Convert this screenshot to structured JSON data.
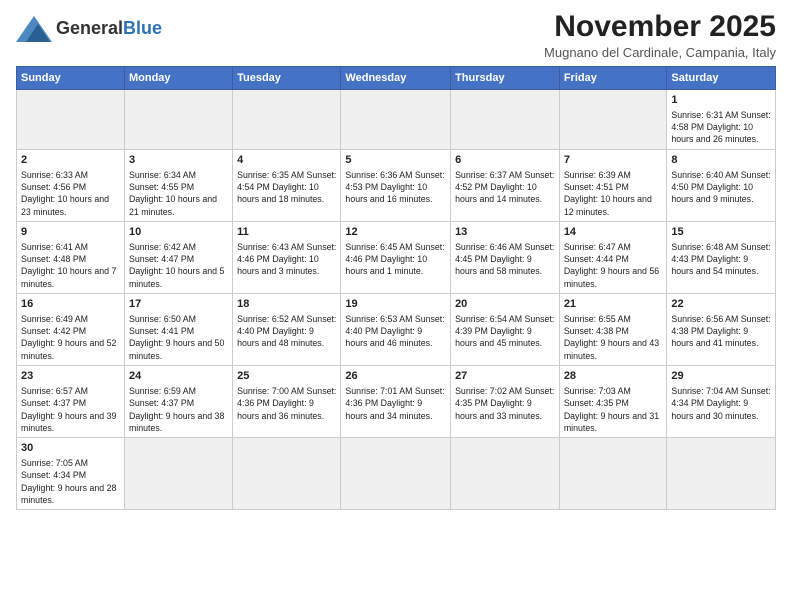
{
  "header": {
    "logo_general": "General",
    "logo_blue": "Blue",
    "month_title": "November 2025",
    "location": "Mugnano del Cardinale, Campania, Italy"
  },
  "weekdays": [
    "Sunday",
    "Monday",
    "Tuesday",
    "Wednesday",
    "Thursday",
    "Friday",
    "Saturday"
  ],
  "weeks": [
    [
      {
        "day": "",
        "info": ""
      },
      {
        "day": "",
        "info": ""
      },
      {
        "day": "",
        "info": ""
      },
      {
        "day": "",
        "info": ""
      },
      {
        "day": "",
        "info": ""
      },
      {
        "day": "",
        "info": ""
      },
      {
        "day": "1",
        "info": "Sunrise: 6:31 AM\nSunset: 4:58 PM\nDaylight: 10 hours and 26 minutes."
      }
    ],
    [
      {
        "day": "2",
        "info": "Sunrise: 6:33 AM\nSunset: 4:56 PM\nDaylight: 10 hours and 23 minutes."
      },
      {
        "day": "3",
        "info": "Sunrise: 6:34 AM\nSunset: 4:55 PM\nDaylight: 10 hours and 21 minutes."
      },
      {
        "day": "4",
        "info": "Sunrise: 6:35 AM\nSunset: 4:54 PM\nDaylight: 10 hours and 18 minutes."
      },
      {
        "day": "5",
        "info": "Sunrise: 6:36 AM\nSunset: 4:53 PM\nDaylight: 10 hours and 16 minutes."
      },
      {
        "day": "6",
        "info": "Sunrise: 6:37 AM\nSunset: 4:52 PM\nDaylight: 10 hours and 14 minutes."
      },
      {
        "day": "7",
        "info": "Sunrise: 6:39 AM\nSunset: 4:51 PM\nDaylight: 10 hours and 12 minutes."
      },
      {
        "day": "8",
        "info": "Sunrise: 6:40 AM\nSunset: 4:50 PM\nDaylight: 10 hours and 9 minutes."
      }
    ],
    [
      {
        "day": "9",
        "info": "Sunrise: 6:41 AM\nSunset: 4:48 PM\nDaylight: 10 hours and 7 minutes."
      },
      {
        "day": "10",
        "info": "Sunrise: 6:42 AM\nSunset: 4:47 PM\nDaylight: 10 hours and 5 minutes."
      },
      {
        "day": "11",
        "info": "Sunrise: 6:43 AM\nSunset: 4:46 PM\nDaylight: 10 hours and 3 minutes."
      },
      {
        "day": "12",
        "info": "Sunrise: 6:45 AM\nSunset: 4:46 PM\nDaylight: 10 hours and 1 minute."
      },
      {
        "day": "13",
        "info": "Sunrise: 6:46 AM\nSunset: 4:45 PM\nDaylight: 9 hours and 58 minutes."
      },
      {
        "day": "14",
        "info": "Sunrise: 6:47 AM\nSunset: 4:44 PM\nDaylight: 9 hours and 56 minutes."
      },
      {
        "day": "15",
        "info": "Sunrise: 6:48 AM\nSunset: 4:43 PM\nDaylight: 9 hours and 54 minutes."
      }
    ],
    [
      {
        "day": "16",
        "info": "Sunrise: 6:49 AM\nSunset: 4:42 PM\nDaylight: 9 hours and 52 minutes."
      },
      {
        "day": "17",
        "info": "Sunrise: 6:50 AM\nSunset: 4:41 PM\nDaylight: 9 hours and 50 minutes."
      },
      {
        "day": "18",
        "info": "Sunrise: 6:52 AM\nSunset: 4:40 PM\nDaylight: 9 hours and 48 minutes."
      },
      {
        "day": "19",
        "info": "Sunrise: 6:53 AM\nSunset: 4:40 PM\nDaylight: 9 hours and 46 minutes."
      },
      {
        "day": "20",
        "info": "Sunrise: 6:54 AM\nSunset: 4:39 PM\nDaylight: 9 hours and 45 minutes."
      },
      {
        "day": "21",
        "info": "Sunrise: 6:55 AM\nSunset: 4:38 PM\nDaylight: 9 hours and 43 minutes."
      },
      {
        "day": "22",
        "info": "Sunrise: 6:56 AM\nSunset: 4:38 PM\nDaylight: 9 hours and 41 minutes."
      }
    ],
    [
      {
        "day": "23",
        "info": "Sunrise: 6:57 AM\nSunset: 4:37 PM\nDaylight: 9 hours and 39 minutes."
      },
      {
        "day": "24",
        "info": "Sunrise: 6:59 AM\nSunset: 4:37 PM\nDaylight: 9 hours and 38 minutes."
      },
      {
        "day": "25",
        "info": "Sunrise: 7:00 AM\nSunset: 4:36 PM\nDaylight: 9 hours and 36 minutes."
      },
      {
        "day": "26",
        "info": "Sunrise: 7:01 AM\nSunset: 4:36 PM\nDaylight: 9 hours and 34 minutes."
      },
      {
        "day": "27",
        "info": "Sunrise: 7:02 AM\nSunset: 4:35 PM\nDaylight: 9 hours and 33 minutes."
      },
      {
        "day": "28",
        "info": "Sunrise: 7:03 AM\nSunset: 4:35 PM\nDaylight: 9 hours and 31 minutes."
      },
      {
        "day": "29",
        "info": "Sunrise: 7:04 AM\nSunset: 4:34 PM\nDaylight: 9 hours and 30 minutes."
      }
    ],
    [
      {
        "day": "30",
        "info": "Sunrise: 7:05 AM\nSunset: 4:34 PM\nDaylight: 9 hours and 28 minutes."
      },
      {
        "day": "",
        "info": ""
      },
      {
        "day": "",
        "info": ""
      },
      {
        "day": "",
        "info": ""
      },
      {
        "day": "",
        "info": ""
      },
      {
        "day": "",
        "info": ""
      },
      {
        "day": "",
        "info": ""
      }
    ]
  ]
}
